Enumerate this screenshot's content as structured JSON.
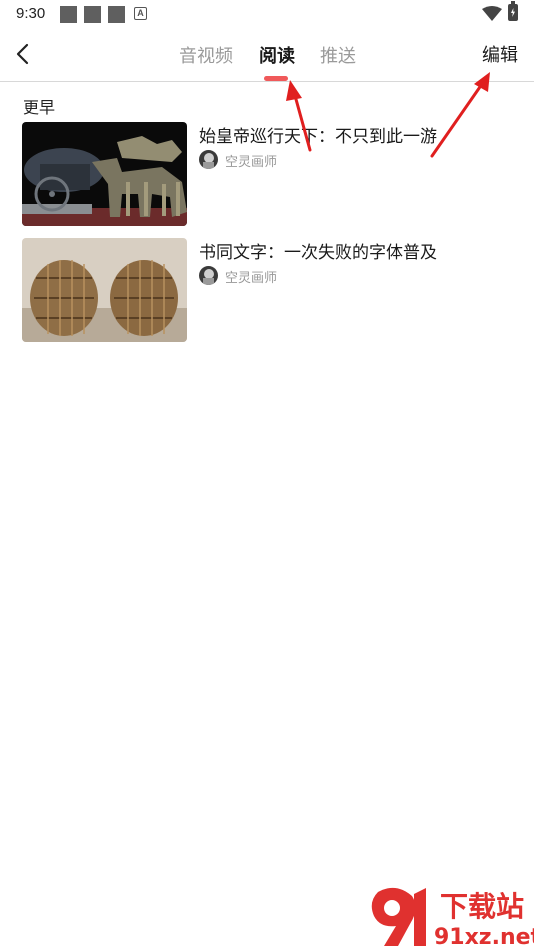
{
  "status_bar": {
    "time": "9:30",
    "notification_badge": "A",
    "icons": [
      "notification-square-icon",
      "notification-square-icon",
      "notification-square-icon",
      "a-badge-icon",
      "wifi-icon",
      "battery-charging-icon"
    ]
  },
  "header": {
    "back_icon": "chevron-left-icon",
    "tabs": [
      {
        "label": "音视频",
        "active": false
      },
      {
        "label": "阅读",
        "active": true
      },
      {
        "label": "推送",
        "active": false
      }
    ],
    "edit_label": "编辑",
    "indicator_color": "#f0595a"
  },
  "section": {
    "title": "更早"
  },
  "items": [
    {
      "title": "始皇帝巡行天下：不只到此一游",
      "author": "空灵画师",
      "thumbnail": "terracotta-chariot-image"
    },
    {
      "title": "书同文字：一次失败的字体普及",
      "author": "空灵画师",
      "thumbnail": "bamboo-slips-image"
    }
  ],
  "watermark": {
    "brand_cn": "下载站",
    "brand_url": "91xz.net",
    "color": "#e0312f"
  },
  "annotation_color": "#e01f1f"
}
